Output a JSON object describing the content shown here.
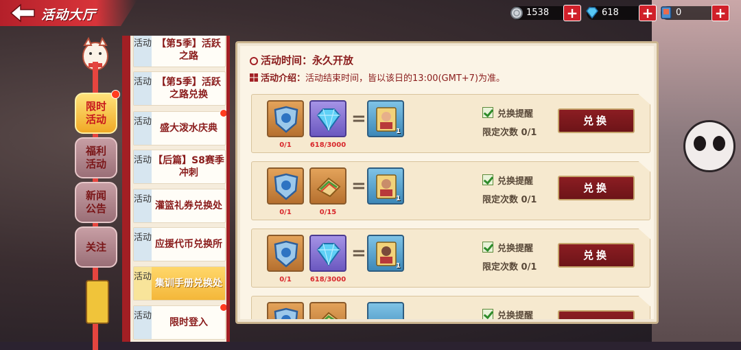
{
  "header": {
    "title": "活动大厅"
  },
  "resources": [
    {
      "name": "coin",
      "value": "1538",
      "icon": "silver-coin-icon"
    },
    {
      "name": "diamond",
      "value": "618",
      "icon": "diamond-icon"
    },
    {
      "name": "card",
      "value": "0",
      "icon": "card-book-icon"
    }
  ],
  "categories": [
    {
      "label": "限时活动",
      "active": true,
      "badge": true
    },
    {
      "label": "福利活动",
      "active": false,
      "badge": false
    },
    {
      "label": "新闻公告",
      "active": false,
      "badge": false
    },
    {
      "label": "关注",
      "active": false,
      "badge": false
    }
  ],
  "activities": [
    {
      "tag": "活动",
      "label": "【第5季】活跃之路",
      "badge": false,
      "selected": false
    },
    {
      "tag": "活动",
      "label": "【第5季】活跃之路兑换",
      "badge": false,
      "selected": false
    },
    {
      "tag": "活动",
      "label": "盛大泼水庆典",
      "badge": true,
      "selected": false
    },
    {
      "tag": "活动",
      "label": "【后篇】S8赛季冲刺",
      "badge": false,
      "selected": false
    },
    {
      "tag": "活动",
      "label": "灌篮礼券兑换处",
      "badge": false,
      "selected": false
    },
    {
      "tag": "活动",
      "label": "应援代币兑换所",
      "badge": false,
      "selected": false
    },
    {
      "tag": "活动",
      "label": "集训手册兑换处",
      "badge": false,
      "selected": true
    },
    {
      "tag": "活动",
      "label": "限时登入",
      "badge": true,
      "selected": false
    }
  ],
  "info": {
    "time_label": "活动时间：",
    "time_value": "永久开放",
    "desc_label": "活动介绍：",
    "desc_value": "活动结束时间，皆以该日的13:00(GMT+7)为准。"
  },
  "exchange": {
    "remind_label": "兑换提醒",
    "limit_label": "限定次数 0/1",
    "button_label": "兑换",
    "equals": "=",
    "rows": [
      {
        "cost1": "0/1",
        "cost2": "618/3000",
        "cost2_type": "diamond",
        "reward_qty": "1"
      },
      {
        "cost1": "0/1",
        "cost2": "0/15",
        "cost2_type": "sandwich",
        "reward_qty": "1"
      },
      {
        "cost1": "0/1",
        "cost2": "618/3000",
        "cost2_type": "diamond",
        "reward_qty": "1"
      },
      {
        "cost1": "",
        "cost2": "",
        "cost2_type": "sandwich",
        "reward_qty": "",
        "partial_remind": "兑换提醒"
      }
    ]
  }
}
